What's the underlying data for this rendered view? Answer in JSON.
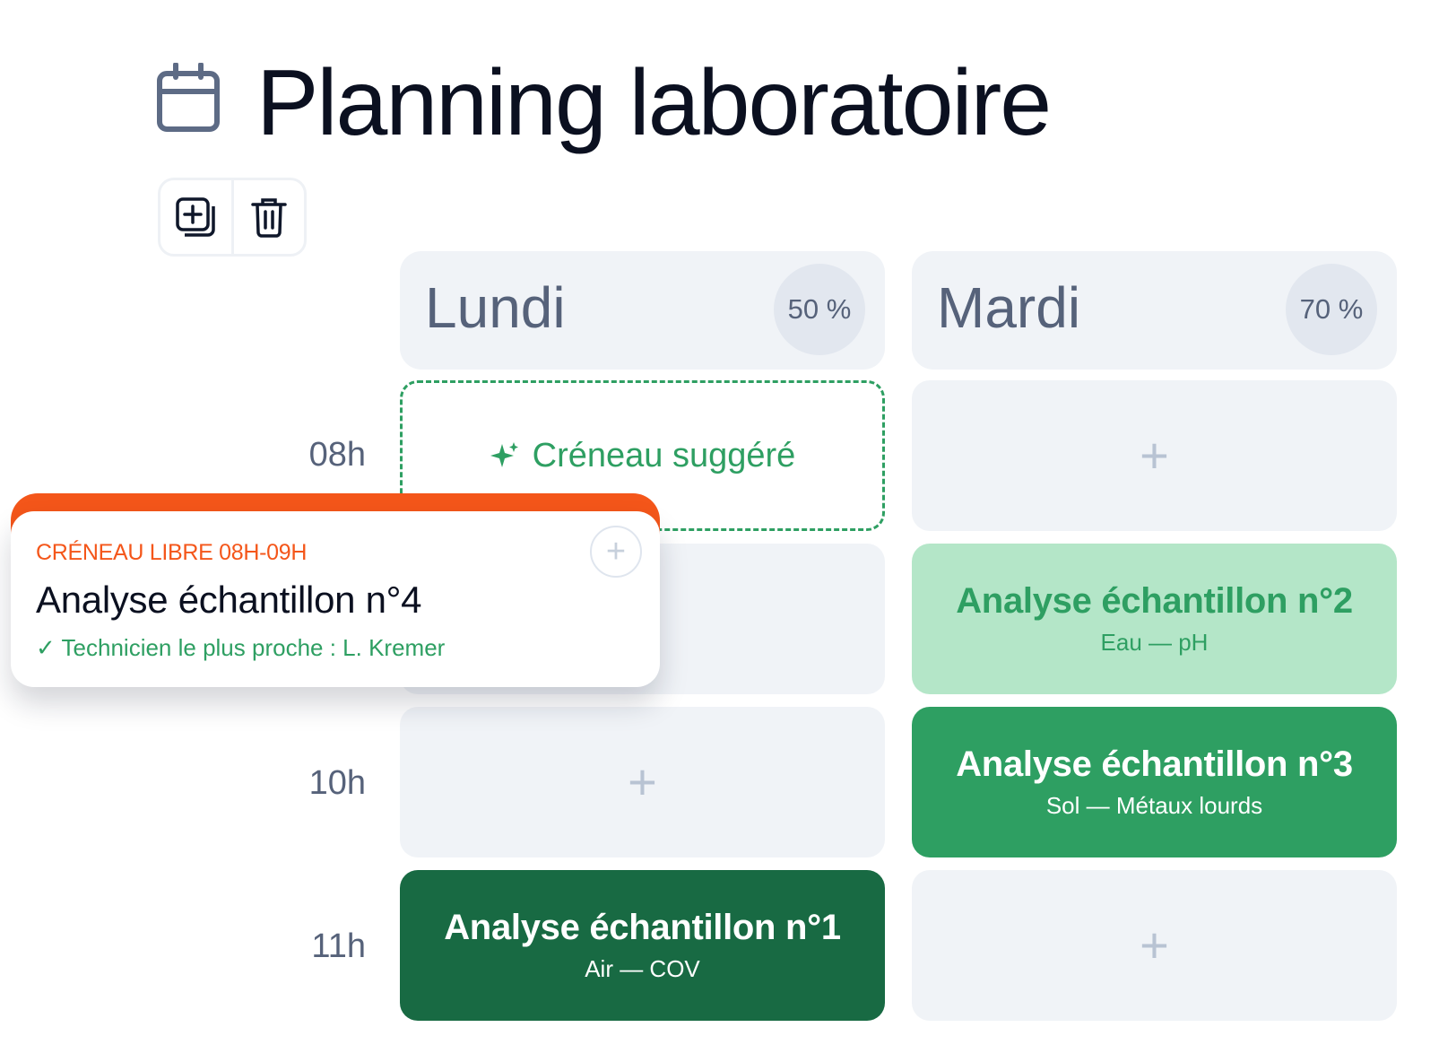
{
  "header": {
    "title": "Planning laboratoire",
    "icon": "calendar-icon"
  },
  "toolbar": {
    "items": [
      {
        "icon": "add-copy-icon"
      },
      {
        "icon": "trash-icon"
      }
    ]
  },
  "days": [
    {
      "name": "Lundi",
      "load": "50 %"
    },
    {
      "name": "Mardi",
      "load": "70 %"
    }
  ],
  "hours": [
    "08h",
    "10h",
    "11h"
  ],
  "slots": {
    "suggested_label": "Créneau suggéré",
    "plus": "+"
  },
  "events": [
    {
      "title": "Analyse échantillon n°2",
      "subtitle": "Eau — pH"
    },
    {
      "title": "Analyse échantillon n°3",
      "subtitle": "Sol — Métaux lourds"
    },
    {
      "title": "Analyse échantillon n°1",
      "subtitle": "Air — COV"
    }
  ],
  "popup": {
    "eyebrow": "CRÉNEAU LIBRE 08H-09H",
    "title": "Analyse échantillon n°4",
    "note": "✓ Technicien le plus proche : L. Kremer",
    "add_symbol": "+"
  },
  "colors": {
    "accent_orange": "#f4561a",
    "green_light": "#b4e6c8",
    "green": "#2e9f62",
    "green_dark": "#186a43",
    "cell_bg": "#f0f3f7"
  }
}
